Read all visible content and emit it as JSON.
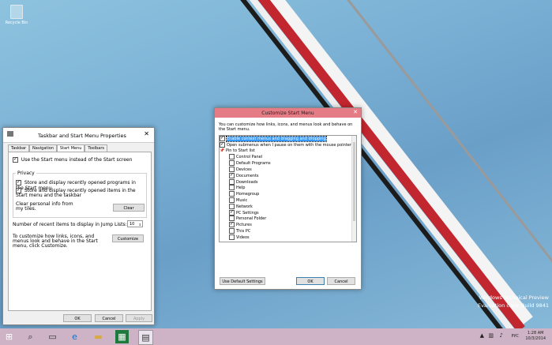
{
  "desktop": {
    "recycle_bin_label": "Recycle Bin",
    "watermark_line1": "Windows Technical Preview",
    "watermark_line2": "Evaluation copy. Build 9841"
  },
  "taskbar_props": {
    "title": "Taskbar and Start Menu Properties",
    "tabs": [
      "Taskbar",
      "Navigation",
      "Start Menu",
      "Toolbars"
    ],
    "active_tab": "Start Menu",
    "use_start_menu": "Use the Start menu instead of the Start screen",
    "privacy_label": "Privacy",
    "store_programs": "Store and display recently opened programs in the Start menu",
    "store_items": "Store and display recently opened items in the Start menu and the taskbar",
    "clear_info": "Clear personal info from my tiles.",
    "clear_button": "Clear",
    "recent_items_label": "Number of recent items to display in Jump Lists:",
    "recent_items_value": "10",
    "customize_desc": "To customize how links, icons, and menus look and behave in the Start menu, click Customize.",
    "customize_button": "Customize",
    "ok": "OK",
    "cancel": "Cancel",
    "apply": "Apply"
  },
  "customize": {
    "title": "Customize Start Menu",
    "description": "You can customize how links, icons, and menus look and behave on the Start menu.",
    "items": [
      {
        "label": "Enable context menus and dragging and dropping",
        "checked": true,
        "sub": false,
        "selected": true
      },
      {
        "label": "Open submenus when I pause on them with the mouse pointer",
        "checked": true,
        "sub": false
      },
      {
        "label": "Pin to Start list",
        "checked": false,
        "sub": false,
        "pin": true
      },
      {
        "label": "Control Panel",
        "checked": false,
        "sub": true
      },
      {
        "label": "Default Programs",
        "checked": false,
        "sub": true
      },
      {
        "label": "Devices",
        "checked": false,
        "sub": true
      },
      {
        "label": "Documents",
        "checked": true,
        "sub": true
      },
      {
        "label": "Downloads",
        "checked": false,
        "sub": true
      },
      {
        "label": "Help",
        "checked": false,
        "sub": true
      },
      {
        "label": "Homegroup",
        "checked": false,
        "sub": true
      },
      {
        "label": "Music",
        "checked": false,
        "sub": true
      },
      {
        "label": "Network",
        "checked": false,
        "sub": true
      },
      {
        "label": "PC Settings",
        "checked": true,
        "sub": true
      },
      {
        "label": "Personal Folder",
        "checked": false,
        "sub": true
      },
      {
        "label": "Pictures",
        "checked": true,
        "sub": true
      },
      {
        "label": "This PC",
        "checked": false,
        "sub": true
      },
      {
        "label": "Videos",
        "checked": false,
        "sub": true
      }
    ],
    "default_settings": "Use Default Settings",
    "ok": "OK",
    "cancel": "Cancel"
  },
  "tray": {
    "lang": "РУС",
    "time": "1:28 AM",
    "date": "10/3/2014"
  }
}
